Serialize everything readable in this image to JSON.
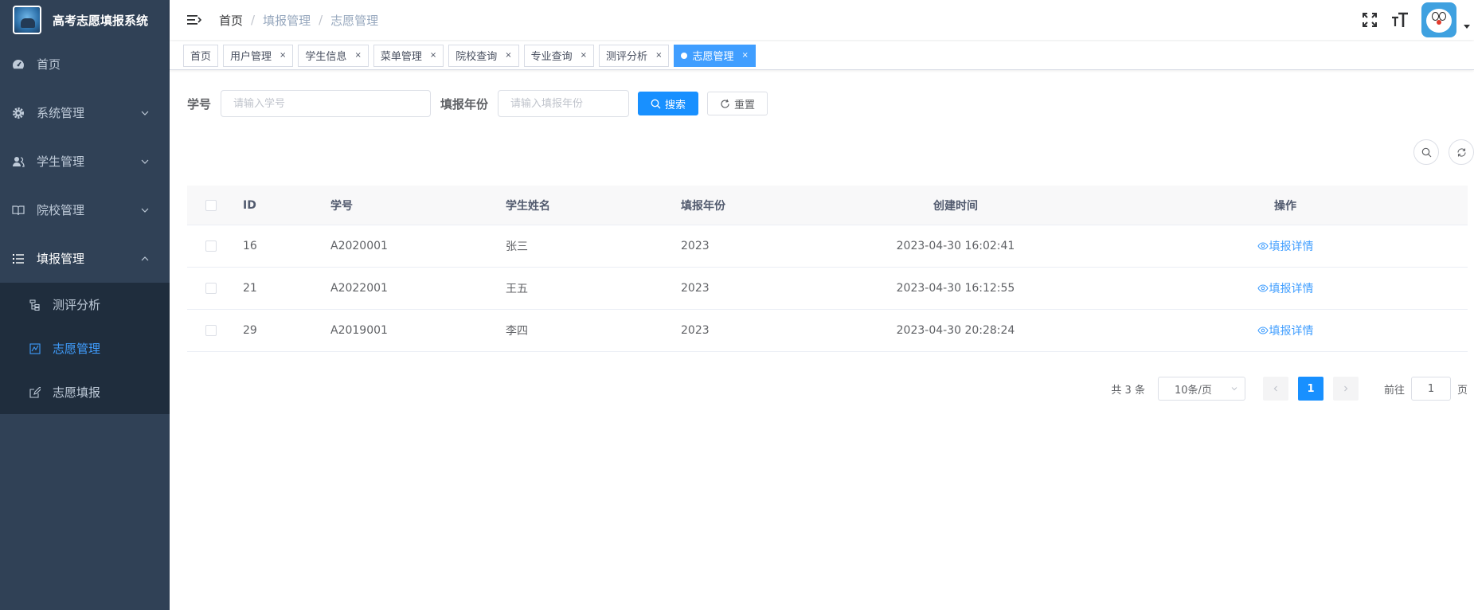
{
  "app": {
    "title": "高考志愿填报系统"
  },
  "sidebar": {
    "items": [
      {
        "label": "首页",
        "icon": "dashboard-icon"
      },
      {
        "label": "系统管理",
        "icon": "gear-icon"
      },
      {
        "label": "学生管理",
        "icon": "users-icon"
      },
      {
        "label": "院校管理",
        "icon": "book-icon"
      },
      {
        "label": "填报管理",
        "icon": "list-icon"
      }
    ],
    "subitems": [
      {
        "label": "测评分析",
        "icon": "tree-icon"
      },
      {
        "label": "志愿管理",
        "icon": "chart-icon",
        "active": true
      },
      {
        "label": "志愿填报",
        "icon": "edit-icon"
      }
    ]
  },
  "breadcrumb": [
    "首页",
    "填报管理",
    "志愿管理"
  ],
  "tags": [
    "首页",
    "用户管理",
    "学生信息",
    "菜单管理",
    "院校查询",
    "专业查询",
    "测评分析",
    "志愿管理"
  ],
  "search": {
    "student_no_label": "学号",
    "student_no_placeholder": "请输入学号",
    "year_label": "填报年份",
    "year_placeholder": "请输入填报年份",
    "search_button": "搜索",
    "reset_button": "重置"
  },
  "table": {
    "headers": [
      "ID",
      "学号",
      "学生姓名",
      "填报年份",
      "创建时间",
      "操作"
    ],
    "rows": [
      {
        "id": "16",
        "no": "A2020001",
        "name": "张三",
        "year": "2023",
        "time": "2023-04-30 16:02:41",
        "action": "填报详情"
      },
      {
        "id": "21",
        "no": "A2022001",
        "name": "王五",
        "year": "2023",
        "time": "2023-04-30 16:12:55",
        "action": "填报详情"
      },
      {
        "id": "29",
        "no": "A2019001",
        "name": "李四",
        "year": "2023",
        "time": "2023-04-30 20:28:24",
        "action": "填报详情"
      }
    ]
  },
  "pagination": {
    "total": "共 3 条",
    "page_size": "10条/页",
    "current": "1",
    "goto_prefix": "前往",
    "goto_value": "1",
    "goto_suffix": "页"
  },
  "colors": {
    "sidebar_bg": "#304156",
    "submenu_bg": "#1f2d3d",
    "primary": "#1890ff",
    "link": "#409eff"
  }
}
